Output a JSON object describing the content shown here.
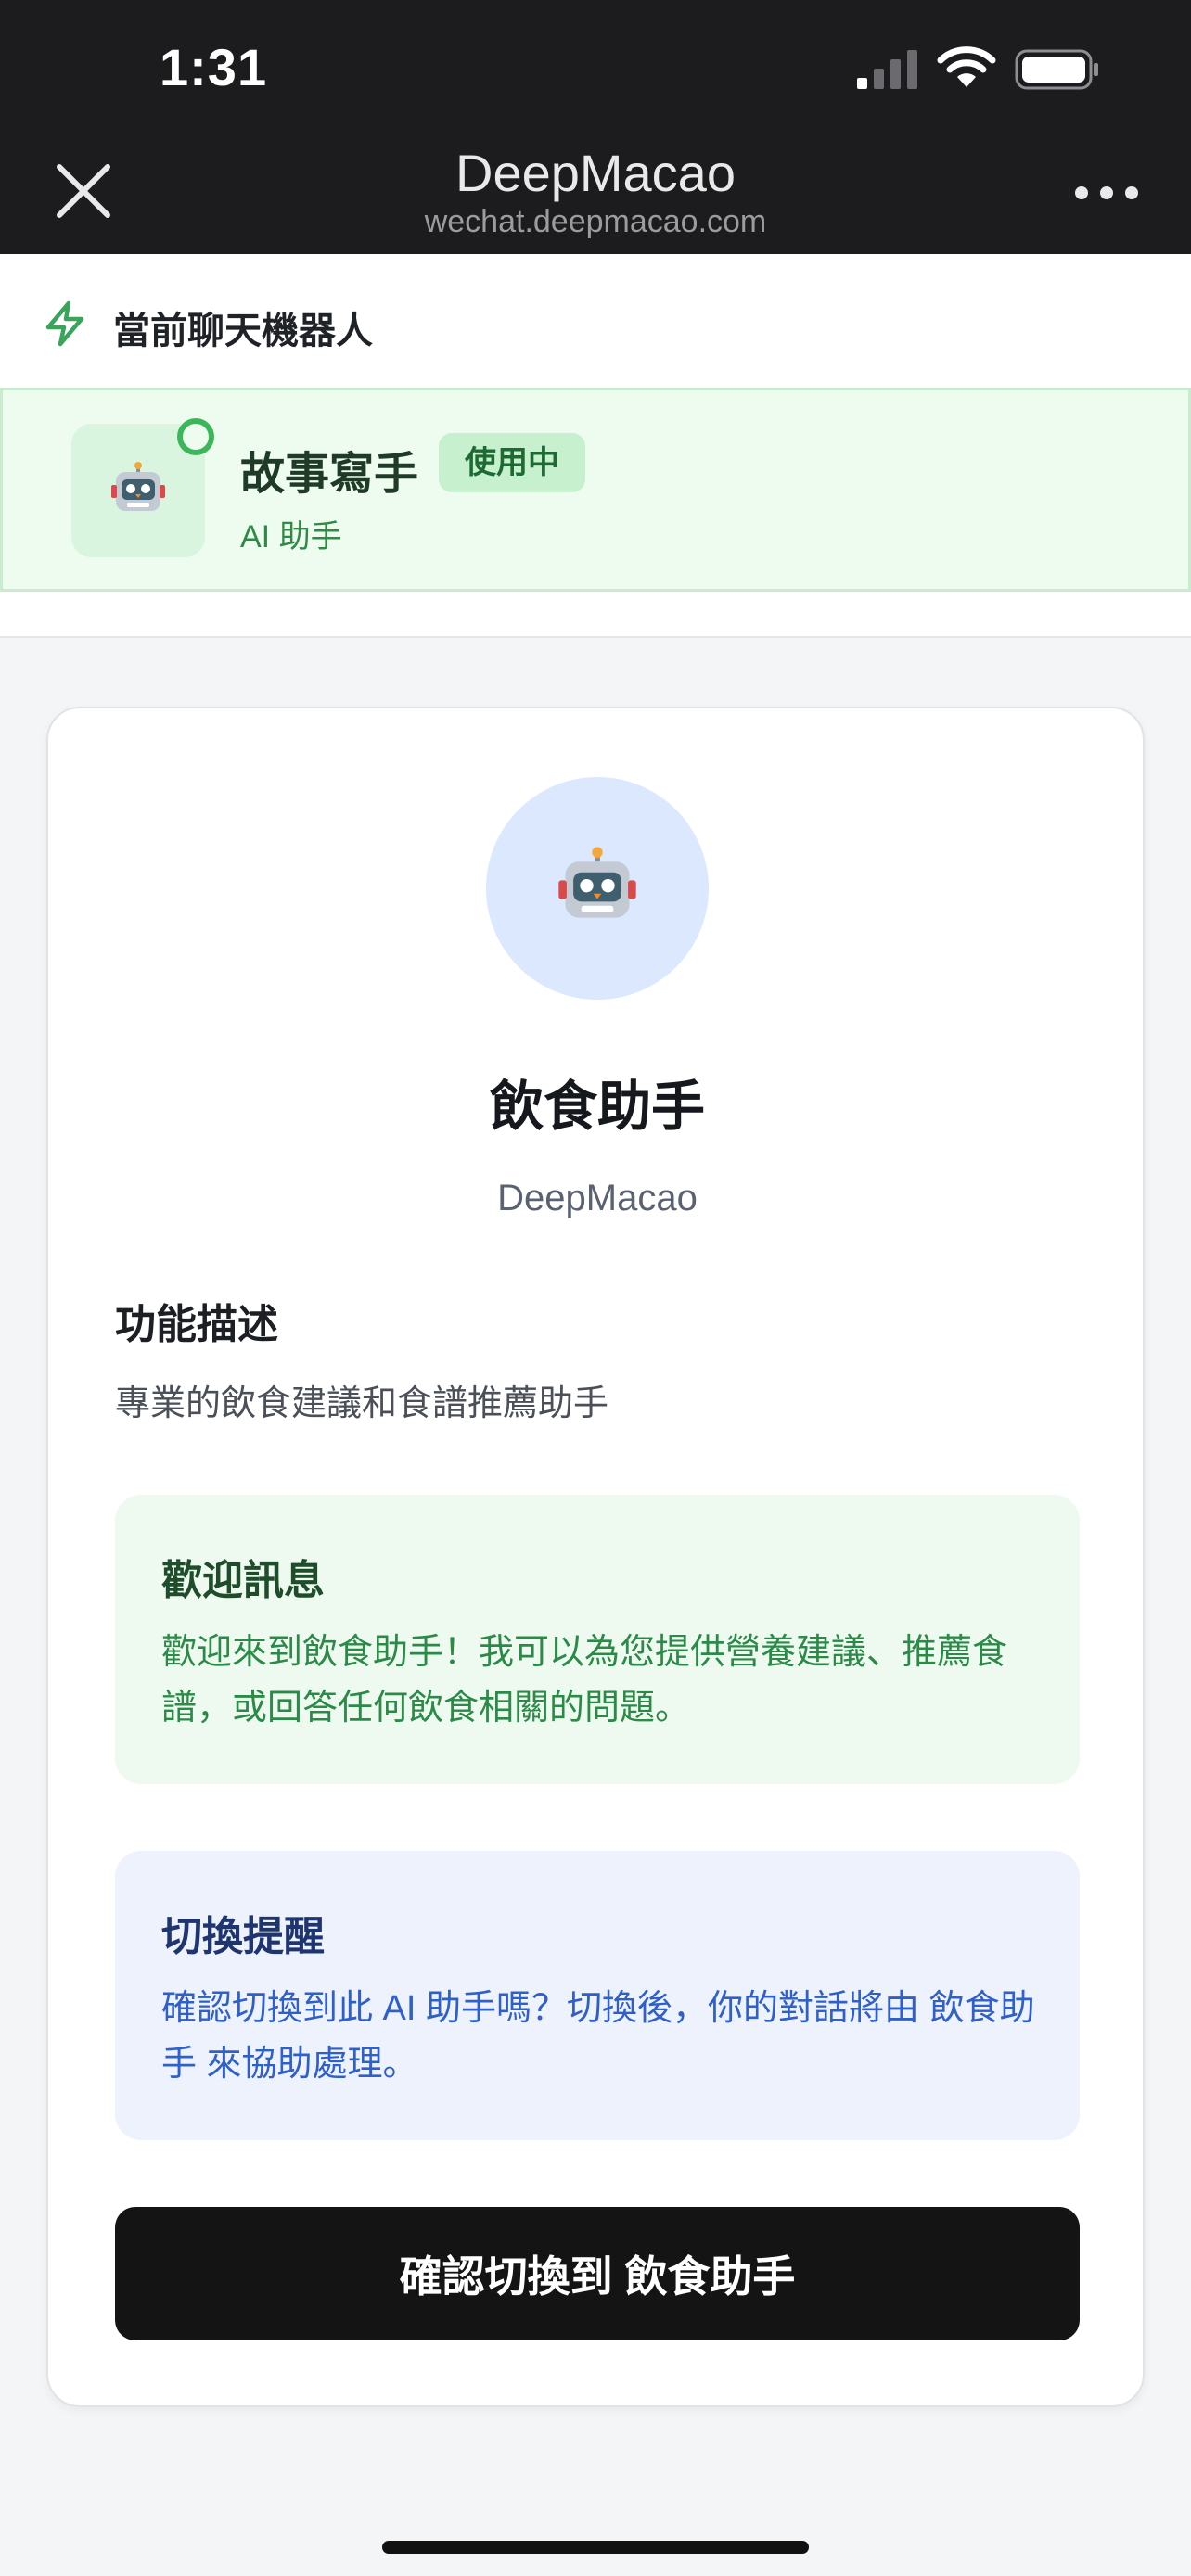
{
  "status_bar": {
    "time": "1:31"
  },
  "nav": {
    "title": "DeepMacao",
    "subtitle": "wechat.deepmacao.com"
  },
  "current": {
    "section_label": "當前聊天機器人",
    "bot_name": "故事寫手",
    "badge": "使用中",
    "role": "AI 助手"
  },
  "bot": {
    "name": "飲食助手",
    "provider": "DeepMacao",
    "description_heading": "功能描述",
    "description": "專業的飲食建議和食譜推薦助手"
  },
  "welcome": {
    "title": "歡迎訊息",
    "text": "歡迎來到飲食助手！我可以為您提供營養建議、推薦食譜，或回答任何飲食相關的問題。"
  },
  "switch_notice": {
    "title": "切換提醒",
    "text": "確認切換到此 AI 助手嗎？切換後，你的對話將由 飲食助手 來協助處理。"
  },
  "confirm_button_label": "確認切換到 飲食助手",
  "colors": {
    "accent_green": "#3bb75a",
    "accent_blue": "#2f5fc9",
    "button_dark": "#141414"
  },
  "icons": [
    "signal-icon",
    "wifi-icon",
    "battery-icon",
    "close-icon",
    "more-icon",
    "bolt-icon",
    "robot-icon"
  ]
}
